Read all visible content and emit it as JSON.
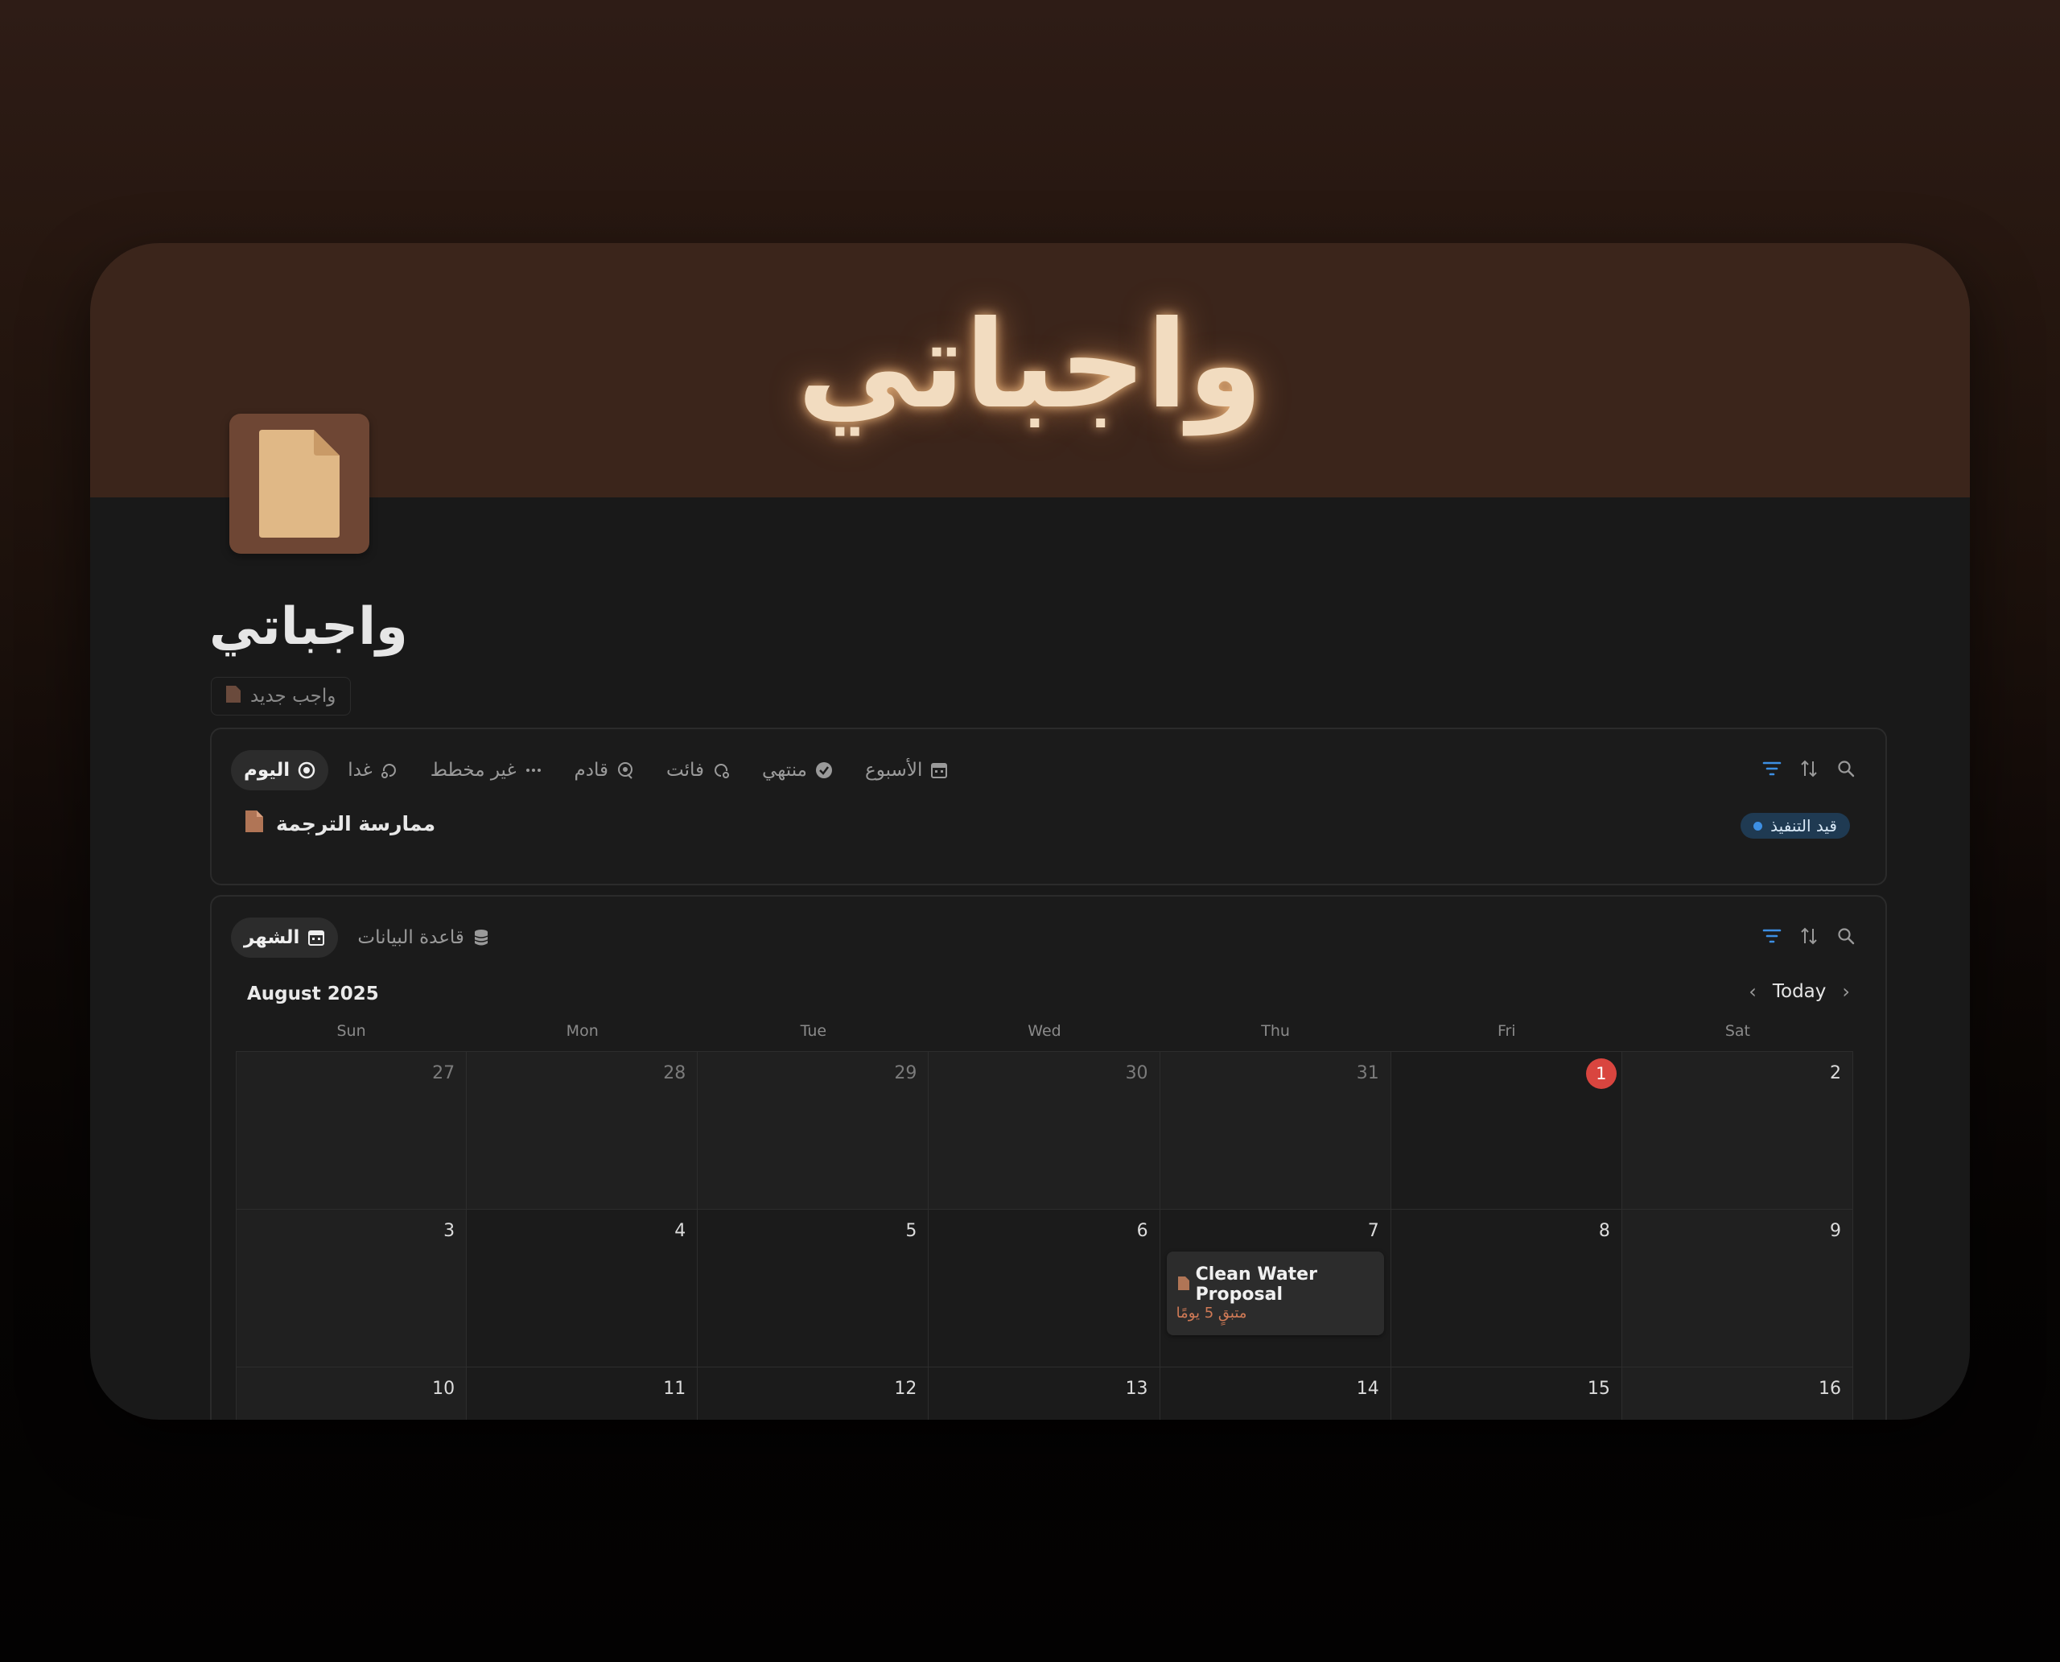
{
  "banner": {
    "title": "واجباتي"
  },
  "page": {
    "title": "واجباتي",
    "new_button_label": "واجب جديد"
  },
  "todo_view": {
    "tabs": [
      {
        "label": "اليوم",
        "icon": "target-icon",
        "active": true
      },
      {
        "label": "غدا",
        "icon": "repeat-icon",
        "active": false
      },
      {
        "label": "غير مخطط",
        "icon": "more-dots-icon",
        "active": false
      },
      {
        "label": "قادم",
        "icon": "upcoming-icon",
        "active": false
      },
      {
        "label": "فائت",
        "icon": "overdue-icon",
        "active": false
      },
      {
        "label": "منتهي",
        "icon": "check-circle-icon",
        "active": false
      },
      {
        "label": "الأسبوع",
        "icon": "calendar-icon",
        "active": false
      }
    ],
    "items": [
      {
        "title": "ممارسة الترجمة",
        "status": "قيد التنفيذ",
        "status_color": "#3d8fe3"
      }
    ]
  },
  "calendar_view": {
    "tabs": [
      {
        "label": "الشهر",
        "icon": "calendar-icon",
        "active": true
      },
      {
        "label": "قاعدة البيانات",
        "icon": "database-icon",
        "active": false
      }
    ],
    "month_label": "August 2025",
    "today_label": "Today",
    "weekdays": [
      "Sun",
      "Mon",
      "Tue",
      "Wed",
      "Thu",
      "Fri",
      "Sat"
    ],
    "days": [
      {
        "n": "27",
        "out": true
      },
      {
        "n": "28",
        "out": true
      },
      {
        "n": "29",
        "out": true
      },
      {
        "n": "30",
        "out": true
      },
      {
        "n": "31",
        "out": true
      },
      {
        "n": "1",
        "today": true
      },
      {
        "n": "2"
      },
      {
        "n": "3"
      },
      {
        "n": "4"
      },
      {
        "n": "5"
      },
      {
        "n": "6"
      },
      {
        "n": "7"
      },
      {
        "n": "8"
      },
      {
        "n": "9"
      },
      {
        "n": "10"
      },
      {
        "n": "11"
      },
      {
        "n": "12"
      },
      {
        "n": "13"
      },
      {
        "n": "14"
      },
      {
        "n": "15"
      },
      {
        "n": "16"
      }
    ],
    "event": {
      "day": "7",
      "title": "Clean Water Proposal",
      "due": "متبقٍ 5 يومًا"
    }
  },
  "colors": {
    "accent_blue": "#3d8fe3",
    "today_red": "#d9453f",
    "icon_brown": "#b07556"
  }
}
